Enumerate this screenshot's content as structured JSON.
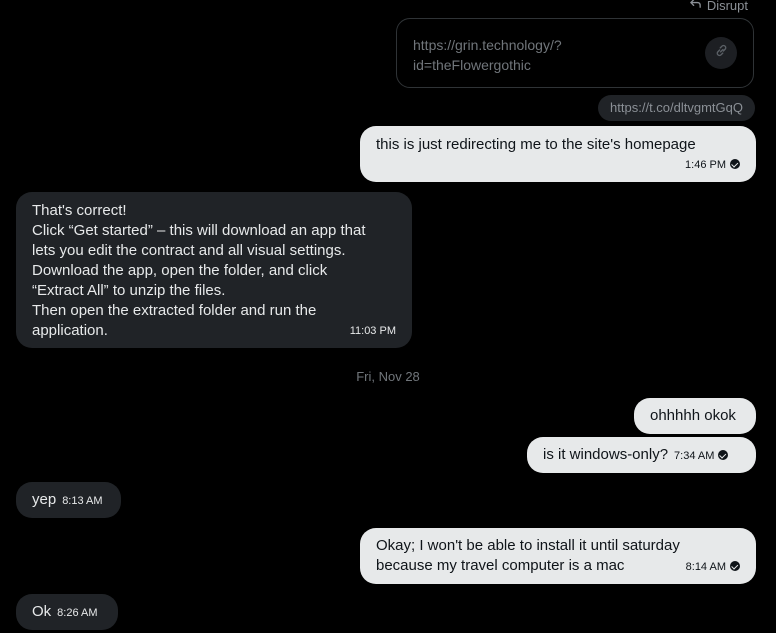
{
  "reply_context": {
    "label": "Disrupt",
    "icon": "reply-arrow-icon"
  },
  "link_preview": {
    "url": "https://grin.technology/?id=theFlowergothic",
    "icon": "link-icon"
  },
  "tco_link": "https://t.co/dltvgmtGqQ",
  "messages": [
    {
      "direction": "sent",
      "text": "this is just redirecting me to the site's homepage",
      "time": "1:46 PM",
      "read": true
    },
    {
      "direction": "received",
      "lines": [
        "That's correct!",
        "Click “Get started” – this will download an app that",
        "lets you edit the contract and all visual settings.",
        "Download the app, open the folder, and click",
        "“Extract All” to unzip the files.",
        "Then open the extracted folder and run the",
        "application."
      ],
      "time": "11:03 PM"
    },
    {
      "direction": "sent",
      "text": "ohhhhh okok"
    },
    {
      "direction": "sent",
      "text": "is it windows-only?",
      "time": "7:34 AM",
      "read": true
    },
    {
      "direction": "received",
      "text": "yep",
      "time": "8:13 AM"
    },
    {
      "direction": "sent",
      "lines": [
        "Okay; I won't be able to install it until saturday",
        "because my travel computer is a mac"
      ],
      "time": "8:14 AM",
      "read": true
    },
    {
      "direction": "received",
      "text": "Ok",
      "time": "8:26 AM"
    }
  ],
  "date_separator": "Fri, Nov 28",
  "colors": {
    "background": "#000000",
    "sent_bubble": "#e7e9ea",
    "received_bubble": "#202327",
    "muted_text": "#71767b"
  }
}
